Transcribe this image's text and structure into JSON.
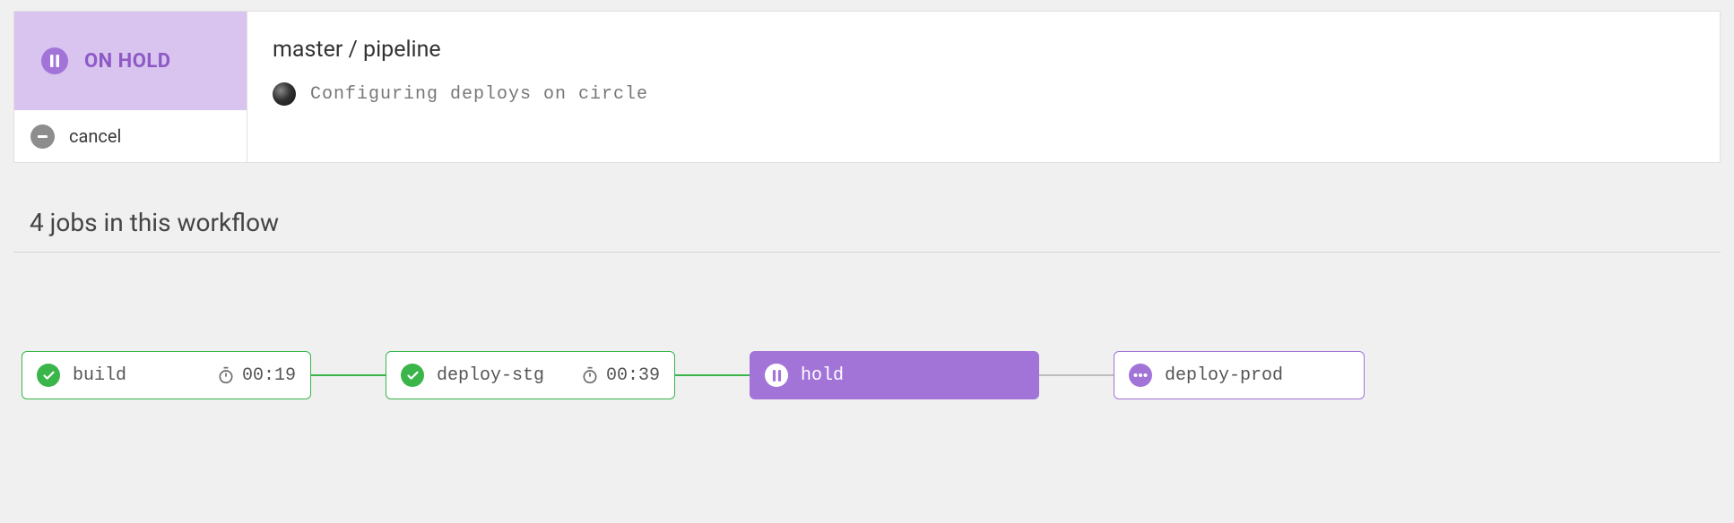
{
  "status": {
    "label": "ON HOLD"
  },
  "cancel": {
    "label": "cancel"
  },
  "pipeline": {
    "title": "master / pipeline",
    "commit_message": "Configuring deploys on circle"
  },
  "jobs_header": "4 jobs in this workflow",
  "nodes": {
    "build": {
      "label": "build",
      "duration": "00:19"
    },
    "deploy_stg": {
      "label": "deploy-stg",
      "duration": "00:39"
    },
    "hold": {
      "label": "hold"
    },
    "deploy_prod": {
      "label": "deploy-prod"
    }
  }
}
